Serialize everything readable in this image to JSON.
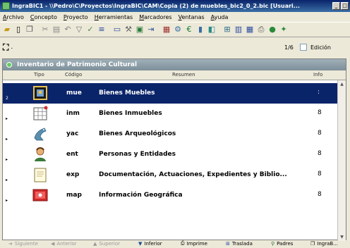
{
  "window": {
    "title": "IngraBIC1 - \\\\Pedro\\C\\Proyectos\\IngraBIC\\CAM\\Copia (2) de muebles_bic2_0_2.bic  [Usuari..."
  },
  "menu": [
    "Archivo",
    "Concepto",
    "Proyecto",
    "Herramientas",
    "Marcadores",
    "Ventanas",
    "Ayuda"
  ],
  "nav": {
    "page_count": "1/6",
    "edit_label": "Edición"
  },
  "panel": {
    "title": "Inventario de Patrimonio Cultural",
    "columns": {
      "tipo": "Tipo",
      "codigo": "Código",
      "resumen": "Resumen",
      "info": "Info"
    },
    "rows": [
      {
        "code": "mue",
        "summary": "Bienes Muebles",
        "info": "",
        "marker": "2",
        "icon": "museum-icon"
      },
      {
        "code": "inm",
        "summary": "Bienes Inmuebles",
        "info": "8",
        "marker": "",
        "icon": "building-grid-icon"
      },
      {
        "code": "yac",
        "summary": "Bienes Arqueológicos",
        "info": "8",
        "marker": "",
        "icon": "bird-statue-icon"
      },
      {
        "code": "ent",
        "summary": "Personas y Entidades",
        "info": "8",
        "marker": "",
        "icon": "person-icon"
      },
      {
        "code": "exp",
        "summary": "Documentación, Actuaciones, Expedientes y Biblio...",
        "info": "8",
        "marker": "",
        "icon": "document-icon"
      },
      {
        "code": "map",
        "summary": "Información Geográfica",
        "info": "8",
        "marker": "",
        "icon": "map-icon"
      }
    ]
  },
  "bottom_buttons": [
    {
      "label": "Siguiente",
      "enabled": false
    },
    {
      "label": "Anterior",
      "enabled": false
    },
    {
      "label": "Superior",
      "enabled": false
    },
    {
      "label": "Inferior",
      "enabled": true
    },
    {
      "label": "Imprime",
      "enabled": true
    },
    {
      "label": "Traslada",
      "enabled": true
    },
    {
      "label": "Padres",
      "enabled": true
    },
    {
      "label": "IngraB...",
      "enabled": true
    }
  ],
  "colors": {
    "selection": "#0a246a",
    "panel_header": "#8a9ba5",
    "title_bar": "#0a246a"
  }
}
